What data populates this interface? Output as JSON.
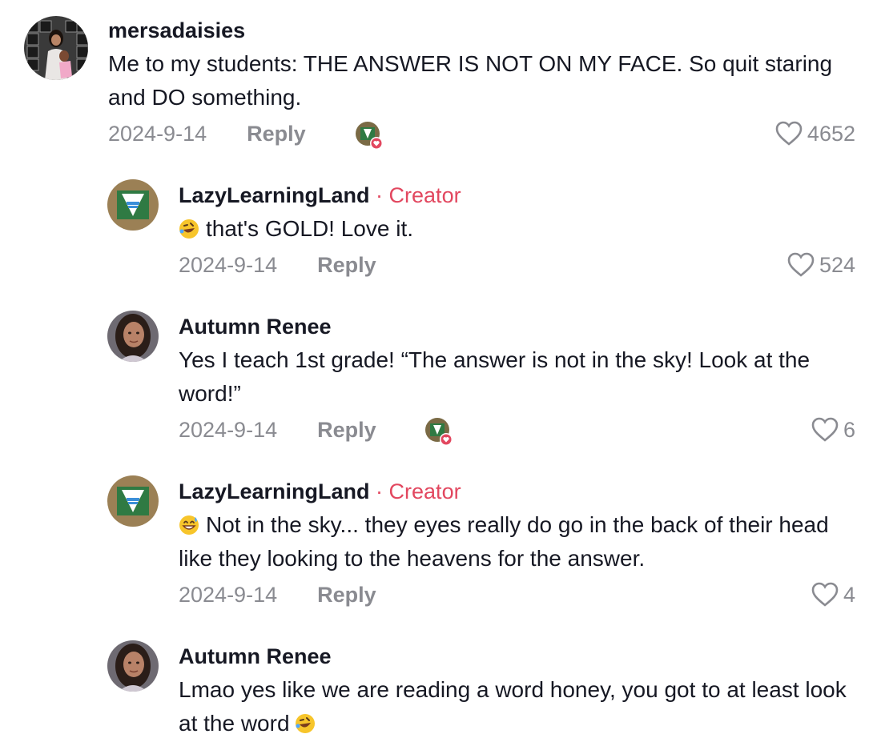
{
  "comments": [
    {
      "username": "mersadaisies",
      "text": "Me to my students: THE ANSWER IS NOT ON MY FACE. So quit staring and DO something.",
      "date": "2024-9-14",
      "reply": "Reply",
      "likes": "4652",
      "liked_by_creator": true
    },
    {
      "username": "LazyLearningLand",
      "creator_tag": "· Creator",
      "emoji": "rolling-on-floor-laughing",
      "text": "that's GOLD! Love it.",
      "date": "2024-9-14",
      "reply": "Reply",
      "likes": "524"
    },
    {
      "username": "Autumn Renee",
      "text": "Yes I teach 1st grade! “The answer is not in the sky! Look at the word!”",
      "date": "2024-9-14",
      "reply": "Reply",
      "likes": "6",
      "liked_by_creator": true
    },
    {
      "username": "LazyLearningLand",
      "creator_tag": "· Creator",
      "emoji": "grinning-face-with-sweat",
      "text": "Not in the sky... they eyes really do go in the back of their head like they looking to the heavens for the answer.",
      "date": "2024-9-14",
      "reply": "Reply",
      "likes": "4"
    },
    {
      "username": "Autumn Renee",
      "text": "Lmao yes like we are reading a word honey, you got to at least look at the word",
      "emoji_trailing": "rolling-on-floor-laughing"
    }
  ],
  "colors": {
    "creator_accent": "#e2475f",
    "muted": "#8a8b91",
    "text": "#161823"
  }
}
